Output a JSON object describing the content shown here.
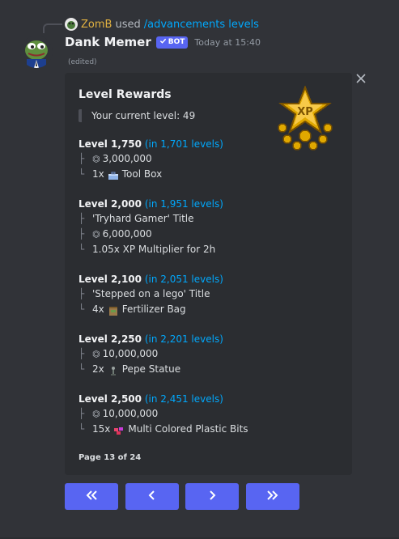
{
  "reply": {
    "user": "ZomB",
    "used_text": "used",
    "command": "/advancements levels"
  },
  "message": {
    "username": "Dank Memer",
    "bot_badge": "BOT",
    "timestamp": "Today at 15:40",
    "edited": "(edited)"
  },
  "embed": {
    "title": "Level Rewards",
    "current_level": "Your current level: 49",
    "levels": [
      {
        "level": "Level 1,750",
        "in": "(in 1,701 levels)",
        "rewards": [
          {
            "tree": "├",
            "coin": true,
            "text": "3,000,000"
          },
          {
            "tree": "└",
            "qty": "1x",
            "icon": "tool-box-icon",
            "text": "Tool Box"
          }
        ]
      },
      {
        "level": "Level 2,000",
        "in": "(in 1,951 levels)",
        "rewards": [
          {
            "tree": "├",
            "text": "'Tryhard Gamer' Title"
          },
          {
            "tree": "├",
            "coin": true,
            "text": "6,000,000"
          },
          {
            "tree": "└",
            "text": "1.05x XP Multiplier for 2h"
          }
        ]
      },
      {
        "level": "Level 2,100",
        "in": "(in 2,051 levels)",
        "rewards": [
          {
            "tree": "├",
            "text": "'Stepped on a lego' Title"
          },
          {
            "tree": "└",
            "qty": "4x",
            "icon": "fertilizer-bag-icon",
            "text": "Fertilizer Bag"
          }
        ]
      },
      {
        "level": "Level 2,250",
        "in": "(in 2,201 levels)",
        "rewards": [
          {
            "tree": "├",
            "coin": true,
            "text": "10,000,000"
          },
          {
            "tree": "└",
            "qty": "2x",
            "icon": "pepe-statue-icon",
            "text": "Pepe Statue"
          }
        ]
      },
      {
        "level": "Level 2,500",
        "in": "(in 2,451 levels)",
        "rewards": [
          {
            "tree": "├",
            "coin": true,
            "text": "10,000,000"
          },
          {
            "tree": "└",
            "qty": "15x",
            "icon": "plastic-bits-icon",
            "text": "Multi Colored Plastic Bits"
          }
        ]
      }
    ],
    "footer": "Page 13 of 24",
    "coin_glyph": "⏣"
  },
  "buttons": [
    {
      "name": "first-page-button",
      "glyph": "«"
    },
    {
      "name": "prev-page-button",
      "glyph": "‹"
    },
    {
      "name": "next-page-button",
      "glyph": "›"
    },
    {
      "name": "last-page-button",
      "glyph": "»"
    }
  ],
  "colors": {
    "accent": "#5865f2",
    "link": "#00a8fc",
    "reply_user": "#e3b341"
  }
}
